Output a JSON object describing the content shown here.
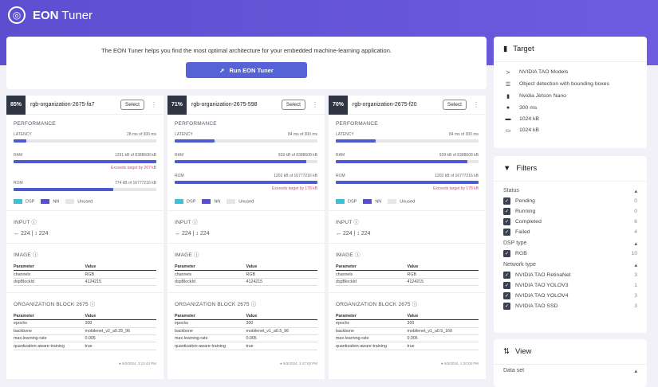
{
  "header": {
    "brand": "EON",
    "title": "Tuner"
  },
  "intro": {
    "text": "The EON Tuner helps you find the most optimal architecture for your embedded machine-learning application.",
    "run_label": "Run EON Tuner"
  },
  "labels": {
    "performance": "PERFORMANCE",
    "latency": "LATENCY",
    "ram": "RAM",
    "rom": "ROM",
    "dsp": "DSP",
    "nn": "NN",
    "unused": "Unused",
    "input": "INPUT",
    "image": "IMAGE",
    "org_block": "ORGANIZATION BLOCK 2675",
    "parameter": "Parameter",
    "value": "Value",
    "select": "Select"
  },
  "colors": {
    "accent": "#5663d6",
    "dsp": "#3ec1d3",
    "nn": "#5a4fcf",
    "unused": "#e6e6ea"
  },
  "cards": [
    {
      "pct": "85%",
      "name": "rgb-organization-2675-fa7",
      "latency": "28 ms of 300 ms",
      "latency_frac": 0.09,
      "ram": "1291 kB of 8388608 kB",
      "ram_frac": 1.0,
      "ram_warn": "Exceeds target by 267 kB",
      "rom": "774 kB of 16777216 kB",
      "rom_frac": 0.7,
      "rom_warn": "",
      "w": "224",
      "h": "224",
      "image": [
        [
          "channels",
          "RGB"
        ],
        [
          "dspBlockId",
          "4124215"
        ]
      ],
      "org": [
        [
          "epochs",
          "300"
        ],
        [
          "backbone",
          "mobilenet_v2_a0.25_96"
        ],
        [
          "max-learning-rate",
          "0.005"
        ],
        [
          "quantization-aware-training",
          "true"
        ]
      ],
      "time": "9/3/2024, 3:13:44 PM"
    },
    {
      "pct": "71%",
      "name": "rgb-organization-2675-598",
      "latency": "84 ms of 300 ms",
      "latency_frac": 0.28,
      "ram": "939 kB of 8388608 kB",
      "ram_frac": 0.92,
      "ram_warn": "",
      "rom": "1202 kB of 16777216 kB",
      "rom_frac": 1.0,
      "rom_warn": "Exceeds target by 178 kB",
      "w": "224",
      "h": "224",
      "image": [
        [
          "channels",
          "RGB"
        ],
        [
          "dspBlockId",
          "4124215"
        ]
      ],
      "org": [
        [
          "epochs",
          "300"
        ],
        [
          "backbone",
          "mobilenet_v1_a0.5_96"
        ],
        [
          "max-learning-rate",
          "0.005"
        ],
        [
          "quantization-aware-training",
          "true"
        ]
      ],
      "time": "9/3/2024, 1:47:00 PM"
    },
    {
      "pct": "70%",
      "name": "rgb-organization-2675-f20",
      "latency": "84 ms of 300 ms",
      "latency_frac": 0.28,
      "ram": "939 kB of 8388608 kB",
      "ram_frac": 0.92,
      "ram_warn": "",
      "rom": "1202 kB of 16777216 kB",
      "rom_frac": 1.0,
      "rom_warn": "Exceeds target by 178 kB",
      "w": "224",
      "h": "224",
      "image": [
        [
          "channels",
          "RGB"
        ],
        [
          "dspBlockId",
          "4124215"
        ]
      ],
      "org": [
        [
          "epochs",
          "300"
        ],
        [
          "backbone",
          "mobilenet_v1_a0.5_160"
        ],
        [
          "max-learning-rate",
          "0.005"
        ],
        [
          "quantization-aware-training",
          "true"
        ]
      ],
      "time": "9/3/2024, 1:20:00 PM"
    }
  ],
  "target": {
    "title": "Target",
    "items": [
      {
        "icon": "model-icon",
        "text": "NVIDIA TAO Models"
      },
      {
        "icon": "database-icon",
        "text": "Object detection with bounding boxes"
      },
      {
        "icon": "device-icon",
        "text": "Nvidia Jetson Nano"
      },
      {
        "icon": "clock-icon",
        "text": "300 ms"
      },
      {
        "icon": "ram-icon",
        "text": "1024 kB"
      },
      {
        "icon": "rom-icon",
        "text": "1024 kB"
      }
    ]
  },
  "filters": {
    "title": "Filters",
    "groups": [
      {
        "name": "Status",
        "items": [
          [
            "Pending",
            "0"
          ],
          [
            "Running",
            "0"
          ],
          [
            "Completed",
            "6"
          ],
          [
            "Failed",
            "4"
          ]
        ]
      },
      {
        "name": "DSP type",
        "items": [
          [
            "RGB",
            "10"
          ]
        ]
      },
      {
        "name": "Network type",
        "items": [
          [
            "NVIDIA TAO RetinaNet",
            "3"
          ],
          [
            "NVIDIA TAO YOLOV3",
            "1"
          ],
          [
            "NVIDIA TAO YOLOV4",
            "3"
          ],
          [
            "NVIDIA TAO SSD",
            "3"
          ]
        ]
      }
    ]
  },
  "view": {
    "title": "View",
    "group": "Data set"
  }
}
